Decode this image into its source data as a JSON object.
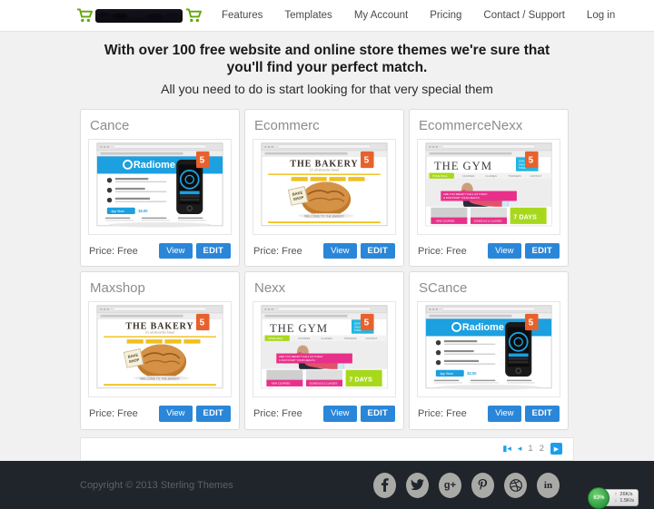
{
  "header": {
    "logo": {
      "cart_icon_left": "shopping-cart-icon",
      "cart_icon_right": "shopping-cart-icon",
      "brand_text": ""
    },
    "nav": [
      {
        "label": "Features"
      },
      {
        "label": "Templates"
      },
      {
        "label": "My Account"
      },
      {
        "label": "Pricing"
      },
      {
        "label": "Contact / Support"
      },
      {
        "label": "Log in"
      }
    ]
  },
  "hero": {
    "title_line1": "With over 100 free website and online store themes we're sure that",
    "title_line2": "you'll find your perfect match.",
    "subtitle": "All you need to do is start looking for that very special them"
  },
  "cards": [
    {
      "title": "Cance",
      "price": "Price: Free",
      "view_label": "View",
      "edit_label": "EDIT",
      "thumb": "radiome"
    },
    {
      "title": "Ecommerc",
      "price": "Price: Free",
      "view_label": "View",
      "edit_label": "EDIT",
      "thumb": "bakery"
    },
    {
      "title": "EcommerceNexx",
      "price": "Price: Free",
      "view_label": "View",
      "edit_label": "EDIT",
      "thumb": "gym"
    },
    {
      "title": "Maxshop",
      "price": "Price: Free",
      "view_label": "View",
      "edit_label": "EDIT",
      "thumb": "bakery"
    },
    {
      "title": "Nexx",
      "price": "Price: Free",
      "view_label": "View",
      "edit_label": "EDIT",
      "thumb": "gym"
    },
    {
      "title": "SCance",
      "price": "Price: Free",
      "view_label": "View",
      "edit_label": "EDIT",
      "thumb": "radiome"
    }
  ],
  "thumbnails": {
    "radiome": {
      "site_title": "Radiome",
      "badge": "HTML5",
      "cta": "App Store",
      "price_tag": "$2.00"
    },
    "bakery": {
      "site_title": "THE BAKERY",
      "tagline": "it's all about the bread",
      "badge": "HTML5",
      "footer_text": "WELCOME TO THE BAKERY"
    },
    "gym": {
      "site_title": "THE GYM",
      "banner": "ARE YOU READY? CALL US TODAY & KICKSTART YOUR HEALTH",
      "promo": "7 DAYS",
      "badge": "HTML5"
    }
  },
  "pagination": {
    "first_icon": "first-page-icon",
    "prev_icon": "previous-page-icon",
    "pages": [
      "1",
      "2"
    ],
    "next_icon": "next-page-icon"
  },
  "footer": {
    "copyright": "Copyright © 2013 Sterling Themes",
    "socials": [
      {
        "name": "facebook-icon",
        "glyph": "f"
      },
      {
        "name": "twitter-icon",
        "glyph": "⚑"
      },
      {
        "name": "google-plus-icon",
        "glyph": "g+"
      },
      {
        "name": "pinterest-icon",
        "glyph": "ᴘ"
      },
      {
        "name": "dribbble-icon",
        "glyph": "⊗"
      },
      {
        "name": "linkedin-icon",
        "glyph": "in"
      }
    ]
  },
  "net_widget": {
    "percent": "63%",
    "upload": "26K/s",
    "download": "1.5K/s"
  },
  "colors": {
    "accent_blue": "#2a86d8",
    "pager_blue": "#1b9df0",
    "footer_bg": "#20242b",
    "page_bg": "#f1f1f1",
    "cart_green": "#62a60a"
  }
}
